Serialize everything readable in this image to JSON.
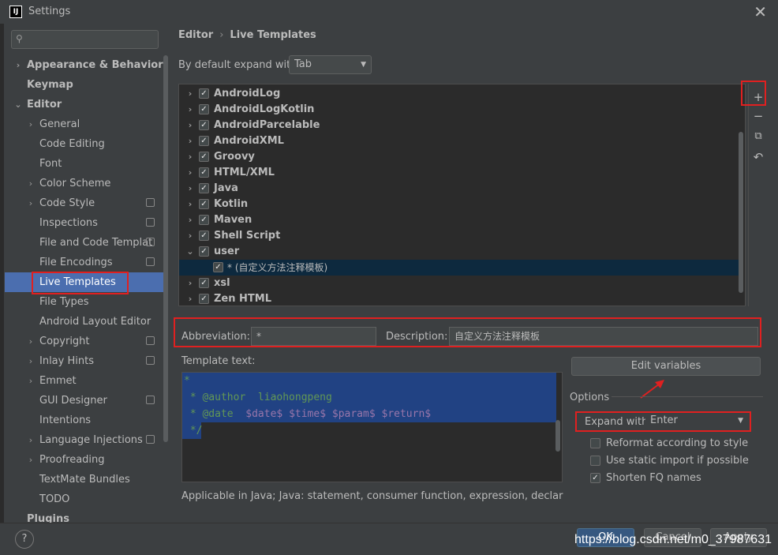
{
  "window": {
    "title": "Settings",
    "logo": "IJ"
  },
  "sidebar": {
    "search_placeholder": "",
    "items": [
      {
        "label": "Appearance & Behavior",
        "arrow": "›",
        "level": 0,
        "bold": true
      },
      {
        "label": "Keymap",
        "arrow": "",
        "level": 0,
        "bold": true
      },
      {
        "label": "Editor",
        "arrow": "⌄",
        "level": 0,
        "bold": true
      },
      {
        "label": "General",
        "arrow": "›",
        "level": 1
      },
      {
        "label": "Code Editing",
        "arrow": "",
        "level": 1
      },
      {
        "label": "Font",
        "arrow": "",
        "level": 1
      },
      {
        "label": "Color Scheme",
        "arrow": "›",
        "level": 1
      },
      {
        "label": "Code Style",
        "arrow": "›",
        "level": 1,
        "icon": true
      },
      {
        "label": "Inspections",
        "arrow": "",
        "level": 1,
        "icon": true
      },
      {
        "label": "File and Code Templat",
        "arrow": "",
        "level": 1,
        "icon": true
      },
      {
        "label": "File Encodings",
        "arrow": "",
        "level": 1,
        "icon": true
      },
      {
        "label": "Live Templates",
        "arrow": "",
        "level": 1,
        "selected": true
      },
      {
        "label": "File Types",
        "arrow": "",
        "level": 1
      },
      {
        "label": "Android Layout Editor",
        "arrow": "",
        "level": 1
      },
      {
        "label": "Copyright",
        "arrow": "›",
        "level": 1,
        "icon": true
      },
      {
        "label": "Inlay Hints",
        "arrow": "›",
        "level": 1,
        "icon": true
      },
      {
        "label": "Emmet",
        "arrow": "›",
        "level": 1
      },
      {
        "label": "GUI Designer",
        "arrow": "",
        "level": 1,
        "icon": true
      },
      {
        "label": "Intentions",
        "arrow": "",
        "level": 1
      },
      {
        "label": "Language Injections",
        "arrow": "›",
        "level": 1,
        "icon": true
      },
      {
        "label": "Proofreading",
        "arrow": "›",
        "level": 1
      },
      {
        "label": "TextMate Bundles",
        "arrow": "",
        "level": 1
      },
      {
        "label": "TODO",
        "arrow": "",
        "level": 1
      },
      {
        "label": "Plugins",
        "arrow": "",
        "level": 0,
        "bold": true
      }
    ]
  },
  "breadcrumb": {
    "part1": "Editor",
    "sep": "›",
    "part2": "Live Templates"
  },
  "expand_default": {
    "label": "By default expand with",
    "value": "Tab"
  },
  "templates": [
    {
      "label": "AndroidLog",
      "arrow": "›",
      "checked": true
    },
    {
      "label": "AndroidLogKotlin",
      "arrow": "›",
      "checked": true
    },
    {
      "label": "AndroidParcelable",
      "arrow": "›",
      "checked": true
    },
    {
      "label": "AndroidXML",
      "arrow": "›",
      "checked": true
    },
    {
      "label": "Groovy",
      "arrow": "›",
      "checked": true
    },
    {
      "label": "HTML/XML",
      "arrow": "›",
      "checked": true
    },
    {
      "label": "Java",
      "arrow": "›",
      "checked": true
    },
    {
      "label": "Kotlin",
      "arrow": "›",
      "checked": true
    },
    {
      "label": "Maven",
      "arrow": "›",
      "checked": true
    },
    {
      "label": "Shell Script",
      "arrow": "›",
      "checked": true
    },
    {
      "label": "user",
      "arrow": "⌄",
      "checked": true
    },
    {
      "label": "* (自定义方法注释模板)",
      "arrow": "",
      "checked": true,
      "sub": true
    },
    {
      "label": "xsl",
      "arrow": "›",
      "checked": true
    },
    {
      "label": "Zen HTML",
      "arrow": "›",
      "checked": true
    }
  ],
  "tools": {
    "add": "+",
    "remove": "−",
    "copy": "⧉",
    "revert": "↶"
  },
  "abbreviation": {
    "label": "Abbreviation:",
    "value": "*"
  },
  "description": {
    "label": "Description:",
    "value": "自定义方法注释模板"
  },
  "template_text": {
    "label": "Template text:",
    "lines": [
      "*",
      " * @author  liaohongpeng",
      " * @date  ",
      " */"
    ],
    "vars": {
      "date": "$date$",
      "time": "$time$",
      "param": "$param$",
      "return": "$return$"
    }
  },
  "edit_variables": "Edit variables",
  "options": {
    "title": "Options",
    "expand_with_label": "Expand with",
    "expand_with_value": "Enter",
    "checks": [
      {
        "label": "Reformat according to style",
        "checked": false
      },
      {
        "label": "Use static import if possible",
        "checked": false
      },
      {
        "label": "Shorten FQ names",
        "checked": true
      }
    ]
  },
  "applicable": "Applicable in Java; Java: statement, consumer function, expression, declaration, con",
  "footer": {
    "help": "?",
    "ok": "OK",
    "cancel": "Cancel",
    "apply": "Apply",
    "watermark": "https://blog.csdn.net/m0_37987631"
  },
  "colors": {
    "accent": "#4b6eaf",
    "annotation_red": "#e02020",
    "bg": "#3c3f41"
  }
}
